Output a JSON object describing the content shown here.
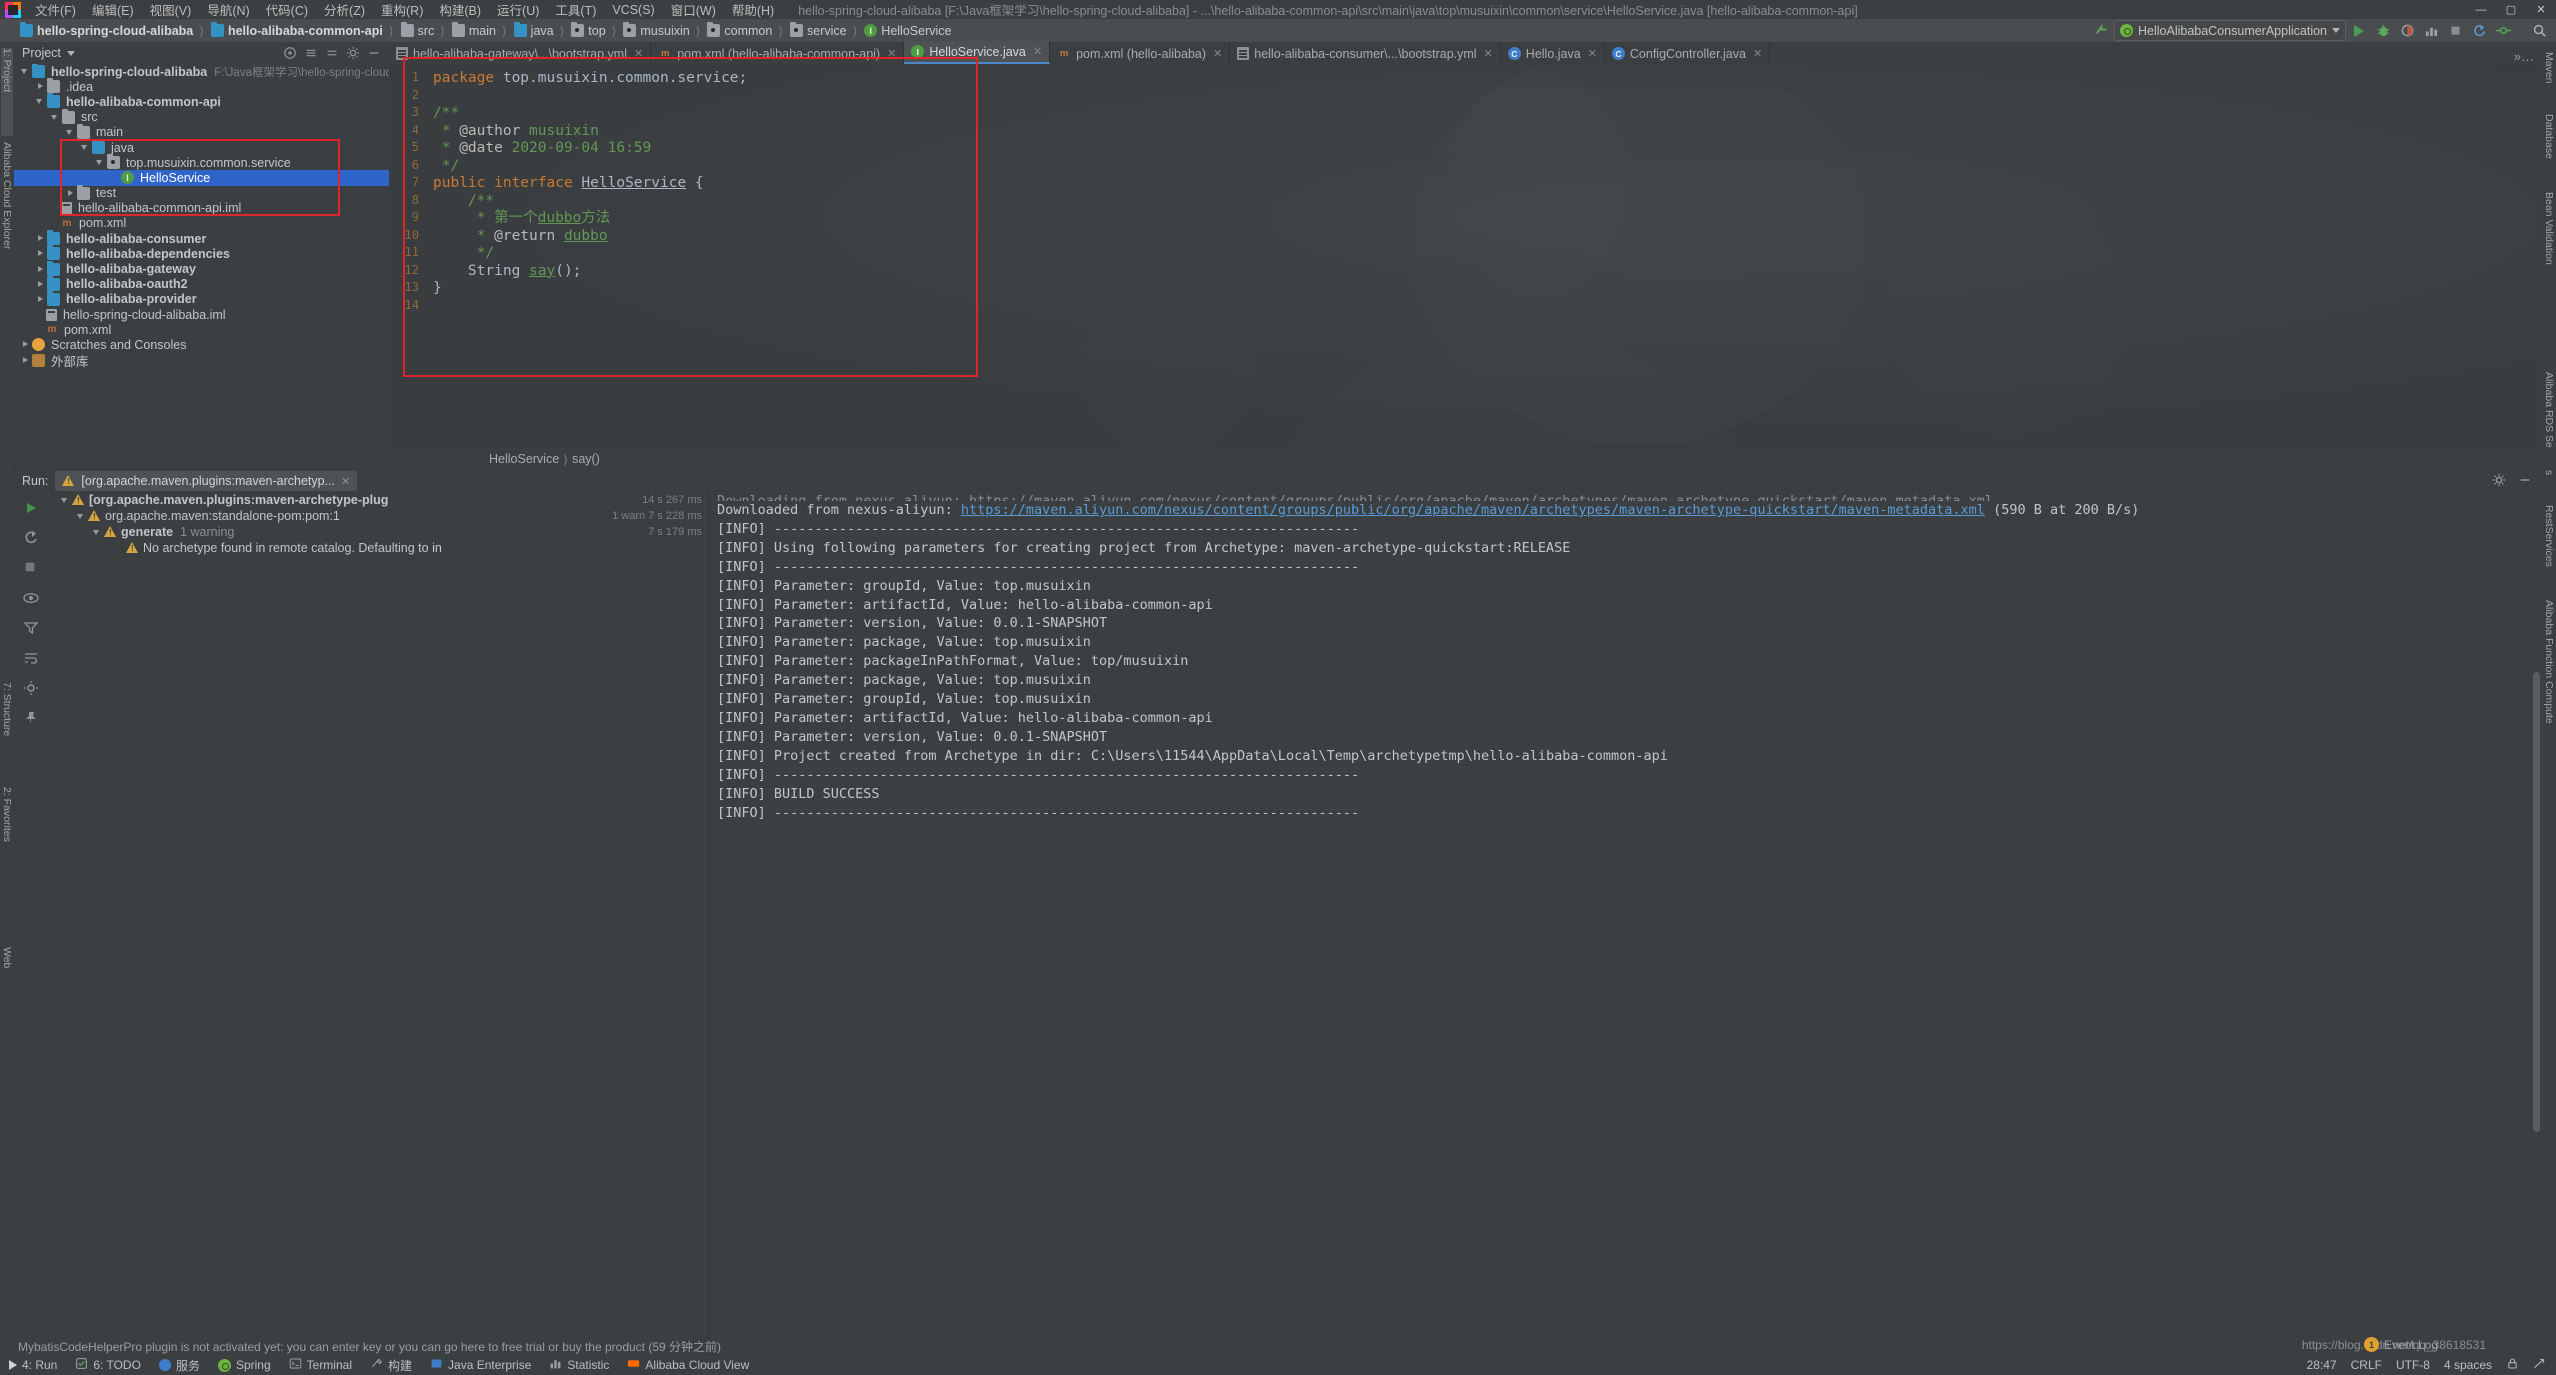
{
  "titlebar": {
    "menus": [
      {
        "label": "文件(F)"
      },
      {
        "label": "编辑(E)"
      },
      {
        "label": "视图(V)"
      },
      {
        "label": "导航(N)"
      },
      {
        "label": "代码(C)"
      },
      {
        "label": "分析(Z)"
      },
      {
        "label": "重构(R)"
      },
      {
        "label": "构建(B)"
      },
      {
        "label": "运行(U)"
      },
      {
        "label": "工具(T)"
      },
      {
        "label": "VCS(S)"
      },
      {
        "label": "窗口(W)"
      },
      {
        "label": "帮助(H)"
      }
    ],
    "window_title": "hello-spring-cloud-alibaba [F:\\Java框架学习\\hello-spring-cloud-alibaba] - ...\\hello-alibaba-common-api\\src\\main\\java\\top\\musuixin\\common\\service\\HelloService.java [hello-alibaba-common-api]",
    "minimize": "—",
    "maximize": "▢",
    "close": "✕"
  },
  "navbar": {
    "breadcrumbs": [
      {
        "label": "hello-spring-cloud-alibaba",
        "icon": "module-icon",
        "bold": true
      },
      {
        "label": "hello-alibaba-common-api",
        "icon": "module-icon",
        "bold": true
      },
      {
        "label": "src",
        "icon": "folder-icon",
        "bold": false
      },
      {
        "label": "main",
        "icon": "folder-icon",
        "bold": false
      },
      {
        "label": "java",
        "icon": "source-folder-icon",
        "bold": false
      },
      {
        "label": "top",
        "icon": "package-icon",
        "bold": false
      },
      {
        "label": "musuixin",
        "icon": "package-icon",
        "bold": false
      },
      {
        "label": "common",
        "icon": "package-icon",
        "bold": false
      },
      {
        "label": "service",
        "icon": "package-icon",
        "bold": false
      },
      {
        "label": "HelloService",
        "icon": "interface-icon",
        "bold": false
      }
    ],
    "run_config": "HelloAlibabaConsumerApplication"
  },
  "left_rail": [
    {
      "label": "1: Project",
      "selected": true
    },
    {
      "label": "Alibaba Cloud Explorer",
      "selected": false
    },
    {
      "label": "7: Structure",
      "selected": false
    },
    {
      "label": "2: Favorites",
      "selected": false
    },
    {
      "label": "Web",
      "selected": false
    }
  ],
  "right_rail": [
    {
      "label": "Maven"
    },
    {
      "label": "Database"
    },
    {
      "label": "Bean Validation"
    },
    {
      "label": "Alibaba RDS Services"
    },
    {
      "label": "RestServices"
    },
    {
      "label": "Alibaba Function Compute"
    }
  ],
  "project_panel": {
    "title": "Project",
    "tree": [
      {
        "indent": 0,
        "arrow": "down",
        "icon": "module-icon",
        "label": "hello-spring-cloud-alibaba",
        "bold": true,
        "path": "F:\\Java框架学习\\hello-spring-cloud-alibaba",
        "selected": false
      },
      {
        "indent": 1,
        "arrow": "right",
        "icon": "folder-icon",
        "label": ".idea",
        "bold": false,
        "path": "",
        "selected": false
      },
      {
        "indent": 1,
        "arrow": "down",
        "icon": "module-icon",
        "label": "hello-alibaba-common-api",
        "bold": true,
        "path": "",
        "selected": false
      },
      {
        "indent": 2,
        "arrow": "down",
        "icon": "folder-icon",
        "label": "src",
        "bold": false,
        "path": "",
        "selected": false
      },
      {
        "indent": 3,
        "arrow": "down",
        "icon": "folder-icon",
        "label": "main",
        "bold": false,
        "path": "",
        "selected": false
      },
      {
        "indent": 4,
        "arrow": "down",
        "icon": "source-folder-icon",
        "label": "java",
        "bold": false,
        "path": "",
        "selected": false
      },
      {
        "indent": 5,
        "arrow": "down",
        "icon": "package-icon",
        "label": "top.musuixin.common.service",
        "bold": false,
        "path": "",
        "selected": false
      },
      {
        "indent": 6,
        "arrow": "none",
        "icon": "interface-icon",
        "label": "HelloService",
        "bold": false,
        "path": "",
        "selected": true
      },
      {
        "indent": 3,
        "arrow": "right",
        "icon": "folder-icon",
        "label": "test",
        "bold": false,
        "path": "",
        "selected": false
      },
      {
        "indent": 2,
        "arrow": "none",
        "icon": "iml-icon",
        "label": "hello-alibaba-common-api.iml",
        "bold": false,
        "path": "",
        "selected": false
      },
      {
        "indent": 2,
        "arrow": "none",
        "icon": "xml-icon",
        "label": "pom.xml",
        "bold": false,
        "path": "",
        "selected": false
      },
      {
        "indent": 1,
        "arrow": "right",
        "icon": "module-icon",
        "label": "hello-alibaba-consumer",
        "bold": true,
        "path": "",
        "selected": false
      },
      {
        "indent": 1,
        "arrow": "right",
        "icon": "module-icon",
        "label": "hello-alibaba-dependencies",
        "bold": true,
        "path": "",
        "selected": false
      },
      {
        "indent": 1,
        "arrow": "right",
        "icon": "module-icon",
        "label": "hello-alibaba-gateway",
        "bold": true,
        "path": "",
        "selected": false
      },
      {
        "indent": 1,
        "arrow": "right",
        "icon": "module-icon",
        "label": "hello-alibaba-oauth2",
        "bold": true,
        "path": "",
        "selected": false
      },
      {
        "indent": 1,
        "arrow": "right",
        "icon": "module-icon",
        "label": "hello-alibaba-provider",
        "bold": true,
        "path": "",
        "selected": false
      },
      {
        "indent": 1,
        "arrow": "none",
        "icon": "iml-icon",
        "label": "hello-spring-cloud-alibaba.iml",
        "bold": false,
        "path": "",
        "selected": false
      },
      {
        "indent": 1,
        "arrow": "none",
        "icon": "xml-icon",
        "label": "pom.xml",
        "bold": false,
        "path": "",
        "selected": false
      },
      {
        "indent": 0,
        "arrow": "right",
        "icon": "scratch-icon",
        "label": "Scratches and Consoles",
        "bold": false,
        "path": "",
        "selected": false
      },
      {
        "indent": 0,
        "arrow": "right",
        "icon": "library-icon",
        "label": "外部库",
        "bold": false,
        "path": "",
        "selected": false
      }
    ]
  },
  "editor_tabs": [
    {
      "label": "hello-alibaba-gateway\\...\\bootstrap.yml",
      "icon": "yml-file-icon",
      "active": false,
      "close": "✕"
    },
    {
      "label": "pom.xml (hello-alibaba-common-api)",
      "icon": "xml-file-icon",
      "active": false,
      "close": "✕"
    },
    {
      "label": "HelloService.java",
      "icon": "interface-file-icon",
      "active": true,
      "close": "✕"
    },
    {
      "label": "pom.xml (hello-alibaba)",
      "icon": "xml-file-icon",
      "active": false,
      "close": "✕"
    },
    {
      "label": "hello-alibaba-consumer\\...\\bootstrap.yml",
      "icon": "yml-file-icon",
      "active": false,
      "close": "✕"
    },
    {
      "label": "Hello.java",
      "icon": "class-file-icon",
      "active": false,
      "close": "✕"
    },
    {
      "label": "ConfigController.java",
      "icon": "class-file-icon",
      "active": false,
      "close": "✕"
    }
  ],
  "code": {
    "line_numbers": [
      "1",
      "2",
      "3",
      "4",
      "5",
      "6",
      "7",
      "8",
      "9",
      "10",
      "11",
      "12",
      "13",
      "14"
    ],
    "lines": [
      "package top.musuixin.common.service;",
      "",
      "/**",
      " * @author musuixin",
      " * @date 2020-09-04 16:59",
      " */",
      "public interface HelloService {",
      "    /**",
      "     * 第一个dubbo方法",
      "     * @return dubbo",
      "     */",
      "    String say();",
      "}",
      ""
    ]
  },
  "editor_breadcrumb": [
    "HelloService",
    "say()"
  ],
  "run_panel": {
    "label": "Run:",
    "tab_label": "[org.apache.maven.plugins:maven-archetyp...",
    "tab_close": "✕",
    "maven_tree": [
      {
        "indent": 0,
        "arrow": "down",
        "label": "[org.apache.maven.plugins:maven-archetype-plug",
        "time": "14 s 267 ms",
        "bold": true,
        "warn": true
      },
      {
        "indent": 1,
        "arrow": "down",
        "label": "org.apache.maven:standalone-pom:pom:1",
        "sub": "1 warn  7 s 228 ms",
        "time": "",
        "bold": false,
        "warn": true
      },
      {
        "indent": 2,
        "arrow": "down",
        "label": "generate",
        "sub": "1 warning",
        "time": "7 s 179 ms",
        "bold": true,
        "warn": true
      },
      {
        "indent": 3,
        "arrow": "none",
        "label": "No archetype found in remote catalog. Defaulting to in",
        "time": "",
        "bold": false,
        "warn": true
      }
    ],
    "console_lines": [
      "Downloaded from nexus-aliyun: https://maven.aliyun.com/nexus/content/groups/public/org/apache/maven/archetypes/maven-archetype-quickstart/maven-metadata.xml (590 B at 200 B/s)",
      "[INFO] ------------------------------------------------------------------------",
      "[INFO] Using following parameters for creating project from Archetype: maven-archetype-quickstart:RELEASE",
      "[INFO] ------------------------------------------------------------------------",
      "[INFO] Parameter: groupId, Value: top.musuixin",
      "[INFO] Parameter: artifactId, Value: hello-alibaba-common-api",
      "[INFO] Parameter: version, Value: 0.0.1-SNAPSHOT",
      "[INFO] Parameter: package, Value: top.musuixin",
      "[INFO] Parameter: packageInPathFormat, Value: top/musuixin",
      "[INFO] Parameter: package, Value: top.musuixin",
      "[INFO] Parameter: groupId, Value: top.musuixin",
      "[INFO] Parameter: artifactId, Value: hello-alibaba-common-api",
      "[INFO] Parameter: version, Value: 0.0.1-SNAPSHOT",
      "[INFO] Project created from Archetype in dir: C:\\Users\\11544\\AppData\\Local\\Temp\\archetypetmp\\hello-alibaba-common-api",
      "[INFO] ------------------------------------------------------------------------",
      "[INFO] BUILD SUCCESS",
      "[INFO] ------------------------------------------------------------------------"
    ],
    "first_line_prefix": "Downloaded from nexus-aliyun: ",
    "first_line_link": "https://maven.aliyun.com/nexus/content/groups/public/org/apache/maven/archetypes/maven-archetype-quickstart/maven-metadata.xml",
    "first_line_suffix": " (590 B at 200 B/s)",
    "top_cut_line": "Downloading from nexus-aliyun: https://maven.aliyun.com/nexus/content/groups/public/org/apache/maven/archetypes/maven-archetype-quickstart/maven-metadata.xml"
  },
  "statusbar": {
    "items": [
      {
        "label": "4: Run",
        "icon": "run-icon"
      },
      {
        "label": "6: TODO",
        "icon": "todo-icon"
      },
      {
        "label": "服务",
        "icon": "services-icon"
      },
      {
        "label": "Spring",
        "icon": "spring-icon"
      },
      {
        "label": "Terminal",
        "icon": "terminal-icon"
      },
      {
        "label": "构建",
        "icon": "build-icon"
      },
      {
        "label": "Java Enterprise",
        "icon": "java-ee-icon"
      },
      {
        "label": "Statistic",
        "icon": "statistic-icon"
      },
      {
        "label": "Alibaba Cloud View",
        "icon": "alibaba-cloud-icon"
      }
    ],
    "notice": "MybatisCodeHelperPro plugin is not activated yet: you can enter key or you can go here to free trial or buy the product (59 分钟之前)",
    "right": [
      "28:47",
      "CRLF",
      "UTF-8",
      "4 spaces"
    ],
    "notification_badge": "1",
    "event_log": "Event Log",
    "watermark": "https://blog.csdn.net/qq_38618531"
  }
}
